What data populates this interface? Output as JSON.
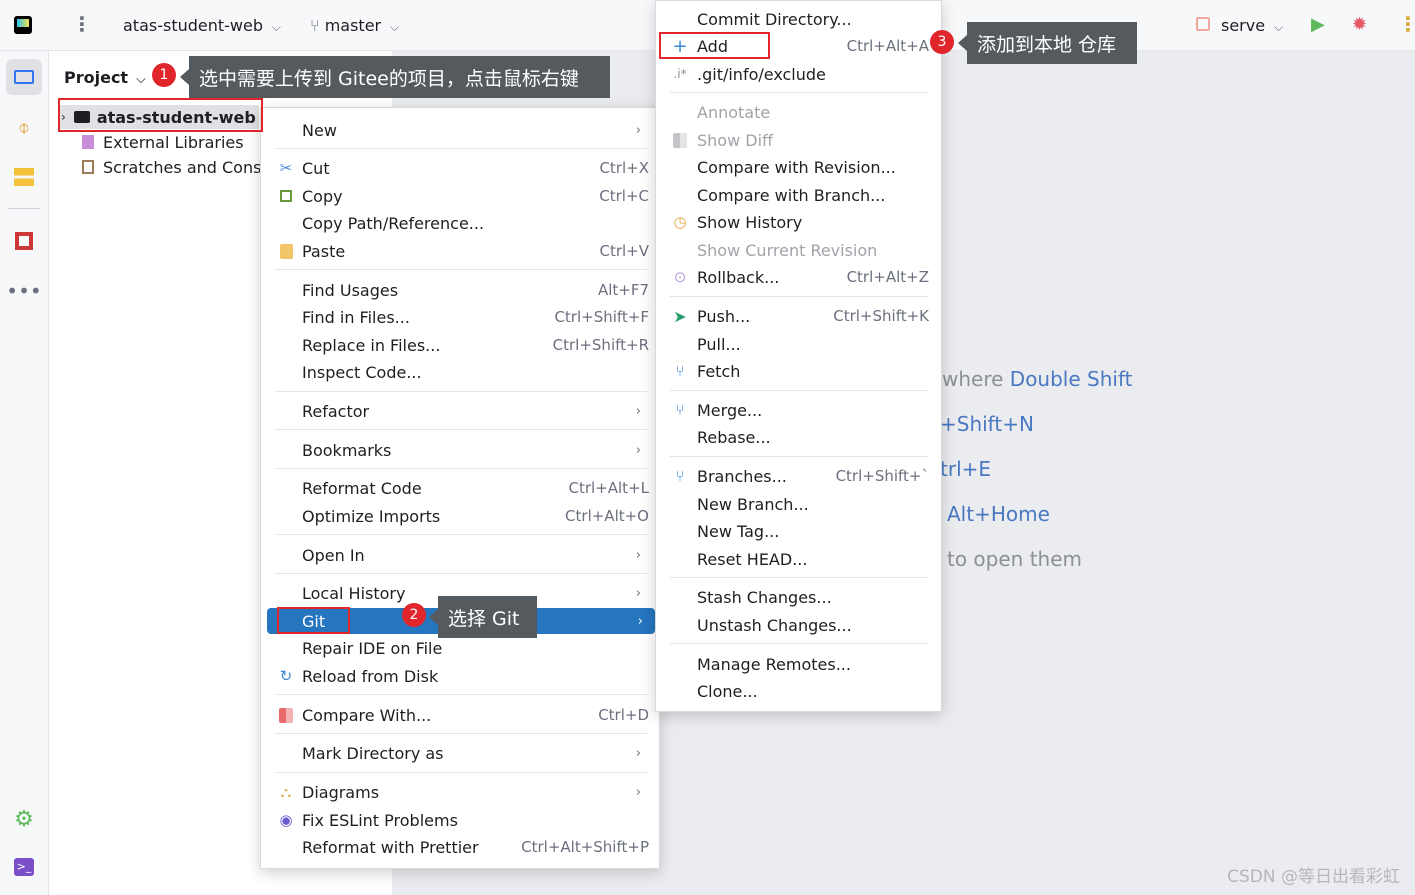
{
  "topbar": {
    "project_name": "atas-student-web",
    "branch": "master",
    "run_config": "serve"
  },
  "project_panel": {
    "title": "Project",
    "tree": [
      {
        "label": "atas-student-web",
        "type": "folder"
      },
      {
        "label": "External Libraries",
        "type": "library"
      },
      {
        "label": "Scratches and Cons",
        "type": "scratch"
      }
    ]
  },
  "context_menu": {
    "items": [
      {
        "label": "New",
        "shortcut": "",
        "submenu": true
      },
      {
        "label": "Cut",
        "shortcut": "Ctrl+X"
      },
      {
        "label": "Copy",
        "shortcut": "Ctrl+C"
      },
      {
        "label": "Copy Path/Reference...",
        "shortcut": ""
      },
      {
        "label": "Paste",
        "shortcut": "Ctrl+V"
      },
      {
        "label": "Find Usages",
        "shortcut": "Alt+F7"
      },
      {
        "label": "Find in Files...",
        "shortcut": "Ctrl+Shift+F"
      },
      {
        "label": "Replace in Files...",
        "shortcut": "Ctrl+Shift+R"
      },
      {
        "label": "Inspect Code...",
        "shortcut": ""
      },
      {
        "label": "Refactor",
        "shortcut": "",
        "submenu": true
      },
      {
        "label": "Bookmarks",
        "shortcut": "",
        "submenu": true
      },
      {
        "label": "Reformat Code",
        "shortcut": "Ctrl+Alt+L"
      },
      {
        "label": "Optimize Imports",
        "shortcut": "Ctrl+Alt+O"
      },
      {
        "label": "Open In",
        "shortcut": "",
        "submenu": true
      },
      {
        "label": "Local History",
        "shortcut": "",
        "submenu": true
      },
      {
        "label": "Git",
        "shortcut": "",
        "submenu": true,
        "selected": true
      },
      {
        "label": "Repair IDE on File",
        "shortcut": ""
      },
      {
        "label": "Reload from Disk",
        "shortcut": ""
      },
      {
        "label": "Compare With...",
        "shortcut": "Ctrl+D"
      },
      {
        "label": "Mark Directory as",
        "shortcut": "",
        "submenu": true
      },
      {
        "label": "Diagrams",
        "shortcut": "",
        "submenu": true
      },
      {
        "label": "Fix ESLint Problems",
        "shortcut": ""
      },
      {
        "label": "Reformat with Prettier",
        "shortcut": "Ctrl+Alt+Shift+P"
      }
    ]
  },
  "git_menu": {
    "items": [
      {
        "label": "Commit Directory...",
        "shortcut": ""
      },
      {
        "label": "Add",
        "shortcut": "Ctrl+Alt+A"
      },
      {
        "label": ".git/info/exclude",
        "shortcut": ""
      },
      {
        "label": "Annotate",
        "shortcut": "",
        "disabled": true
      },
      {
        "label": "Show Diff",
        "shortcut": "",
        "disabled": true
      },
      {
        "label": "Compare with Revision...",
        "shortcut": ""
      },
      {
        "label": "Compare with Branch...",
        "shortcut": ""
      },
      {
        "label": "Show History",
        "shortcut": ""
      },
      {
        "label": "Show Current Revision",
        "shortcut": "",
        "disabled": true
      },
      {
        "label": "Rollback...",
        "shortcut": "Ctrl+Alt+Z"
      },
      {
        "label": "Push...",
        "shortcut": "Ctrl+Shift+K"
      },
      {
        "label": "Pull...",
        "shortcut": ""
      },
      {
        "label": "Fetch",
        "shortcut": ""
      },
      {
        "label": "Merge...",
        "shortcut": ""
      },
      {
        "label": "Rebase...",
        "shortcut": ""
      },
      {
        "label": "Branches...",
        "shortcut": "Ctrl+Shift+`"
      },
      {
        "label": "New Branch...",
        "shortcut": ""
      },
      {
        "label": "New Tag...",
        "shortcut": ""
      },
      {
        "label": "Reset HEAD...",
        "shortcut": ""
      },
      {
        "label": "Stash Changes...",
        "shortcut": ""
      },
      {
        "label": "Unstash Changes...",
        "shortcut": ""
      },
      {
        "label": "Manage Remotes...",
        "shortcut": ""
      },
      {
        "label": "Clone...",
        "shortcut": ""
      }
    ]
  },
  "editor_hints": [
    {
      "text": "where",
      "key": "Double Shift"
    },
    {
      "text": "",
      "key": "+Shift+N"
    },
    {
      "text": "",
      "key": "trl+E"
    },
    {
      "text": "",
      "key": "Alt+Home"
    },
    {
      "text": "to open them",
      "key": ""
    }
  ],
  "annotations": [
    {
      "number": "1",
      "text": "选中需要上传到 Gitee的项目，点击鼠标右键"
    },
    {
      "number": "2",
      "text": "选择 Git"
    },
    {
      "number": "3",
      "text": "添加到本地 仓库"
    }
  ],
  "watermark": "CSDN @等日出看彩虹",
  "colors": {
    "selection": "#2675bf",
    "annotation_red": "#e0262b",
    "callout_bg": "#555a5f",
    "link": "#4a78c2"
  }
}
